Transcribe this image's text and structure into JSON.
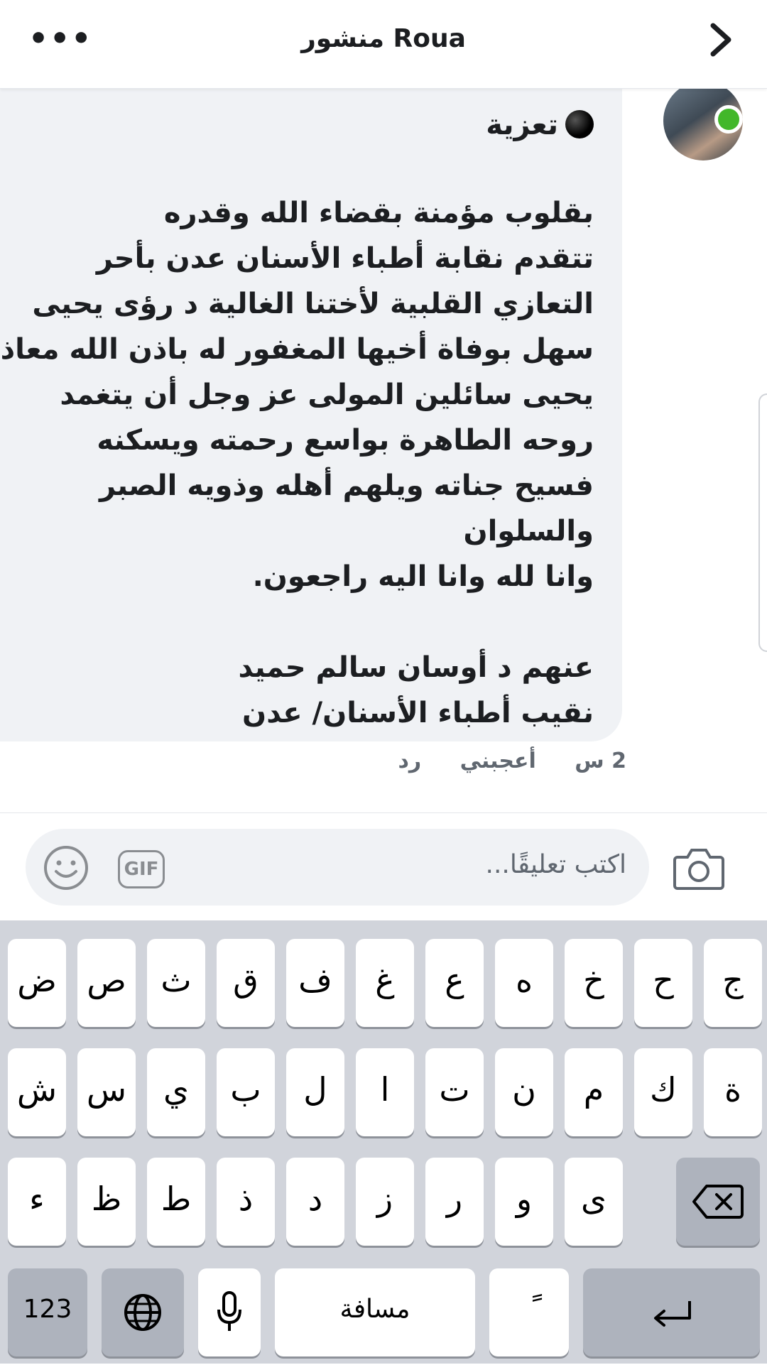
{
  "header": {
    "title": "منشور Roua",
    "more_label": "•••"
  },
  "comment": {
    "heading": "تعزية",
    "lines": [
      "بقلوب مؤمنة بقضاء الله وقدره",
      "تتقدم نقابة أطباء الأسنان عدن بأحر",
      "التعازي القلبية لأختنا الغالية د رؤى يحيى",
      "سهل بوفاة أخيها المغفور له باذن الله معاذ",
      "يحيى سائلين المولى عز وجل أن يتغمد",
      "روحه الطاهرة بواسع رحمته ويسكنه",
      "فسيح جناته ويلهم أهله وذويه الصبر",
      "والسلوان",
      "وانا لله وانا اليه راجعون."
    ],
    "signature": [
      "عنهم د أوسان سالم حميد",
      "نقيب أطباء الأسنان/ عدن"
    ],
    "time": "2 س",
    "like_label": "أعجبني",
    "reply_label": "رد"
  },
  "composer": {
    "placeholder": "اكتب تعليقًا...",
    "gif_label": "GIF"
  },
  "keyboard": {
    "row1": [
      "ج",
      "ح",
      "خ",
      "ه",
      "ع",
      "غ",
      "ف",
      "ق",
      "ث",
      "ص",
      "ض"
    ],
    "row2": [
      "ة",
      "ك",
      "م",
      "ن",
      "ت",
      "ا",
      "ل",
      "ب",
      "ي",
      "س",
      "ش"
    ],
    "row3": [
      "ى",
      "و",
      "ر",
      "ز",
      "د",
      "ذ",
      "ط",
      "ظ",
      "ء"
    ],
    "numbers_label": "123",
    "space_label": "مسافة",
    "diacritic_label": "ً"
  },
  "colors": {
    "bubble": "#f0f2f5",
    "online": "#42b72a",
    "keyboard_bg": "#d1d4db"
  }
}
